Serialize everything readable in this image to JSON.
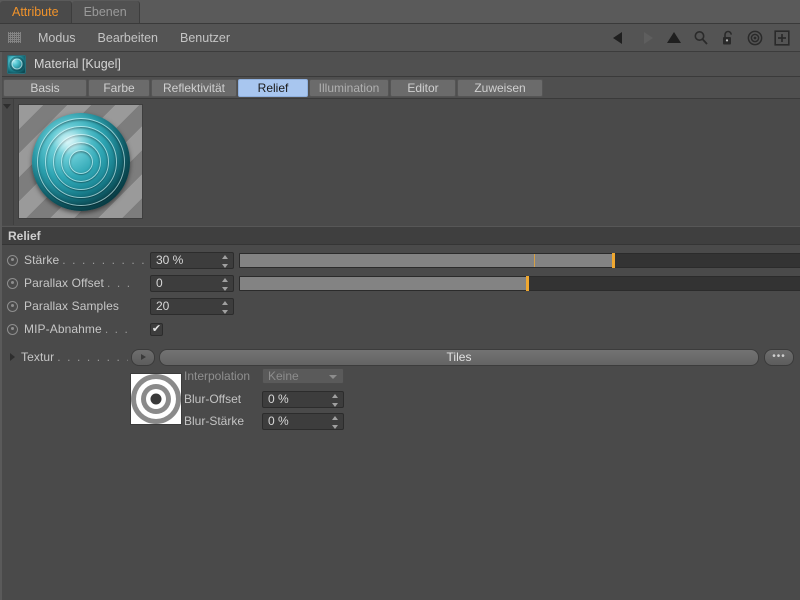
{
  "window_tabs": [
    {
      "label": "Attribute",
      "active": true
    },
    {
      "label": "Ebenen",
      "active": false
    }
  ],
  "menubar": {
    "grip_icon": "hatch-grip-icon",
    "items": [
      "Modus",
      "Bearbeiten",
      "Benutzer"
    ],
    "icons": [
      {
        "name": "back-arrow-icon",
        "glyph": "◀"
      },
      {
        "name": "forward-arrow-icon",
        "glyph": "▶"
      },
      {
        "name": "up-arrow-icon",
        "glyph": "▲"
      },
      {
        "name": "search-icon",
        "glyph": "⚲"
      },
      {
        "name": "lock-icon",
        "glyph": "⚿"
      },
      {
        "name": "target-icon",
        "glyph": "◎"
      },
      {
        "name": "add-box-icon",
        "glyph": "⊞"
      }
    ]
  },
  "object_header": {
    "icon": "material-sphere-icon",
    "title": "Material [Kugel]"
  },
  "page_tabs": [
    {
      "label": "Basis",
      "selected": false
    },
    {
      "label": "Farbe",
      "selected": false
    },
    {
      "label": "Reflektivität",
      "selected": false
    },
    {
      "label": "Relief",
      "selected": true
    },
    {
      "label": "Illumination",
      "selected": false
    },
    {
      "label": "Editor",
      "selected": false
    },
    {
      "label": "Zuweisen",
      "selected": false
    }
  ],
  "preview": {
    "name": "material-preview-sphere",
    "collapse_icon": "triangle-down-icon"
  },
  "group": {
    "title": "Relief"
  },
  "params": {
    "staerke": {
      "label": "Stärke",
      "dots": ". . . . . . . . . .",
      "value": "30 %",
      "slider_percent": 65,
      "tick_percent": 51
    },
    "parallax_offset": {
      "label": "Parallax Offset",
      "dots": ". . .",
      "value": "0",
      "slider_percent": 50
    },
    "parallax_samples": {
      "label": "Parallax Samples",
      "dots": "",
      "value": "20"
    },
    "mip_abnahme": {
      "label": "MIP-Abnahme",
      "dots": ". . .",
      "checked": true,
      "check_glyph": "✔"
    },
    "textur": {
      "label": "Textur",
      "dots": ". . . . . . . . . . .",
      "expand_icon": "triangle-right-icon",
      "arrow_button_icon": "play-arrow-icon",
      "value": "Tiles",
      "more_button_label": "•••"
    }
  },
  "texture_settings": {
    "thumbnail_name": "texture-thumbnail-bullseye",
    "interpolation": {
      "label": "Interpolation",
      "value": "Keine",
      "disabled": true
    },
    "blur_offset": {
      "label": "Blur-Offset",
      "value": "0 %"
    },
    "blur_staerke": {
      "label": "Blur-Stärke",
      "value": "0 %"
    }
  },
  "colors": {
    "background": "#4a4a4a",
    "accent_tab": "#f0932b",
    "selected_tab": "#a8c6ef",
    "slider_handle": "#f0a830",
    "slider_fill": "#838383"
  }
}
